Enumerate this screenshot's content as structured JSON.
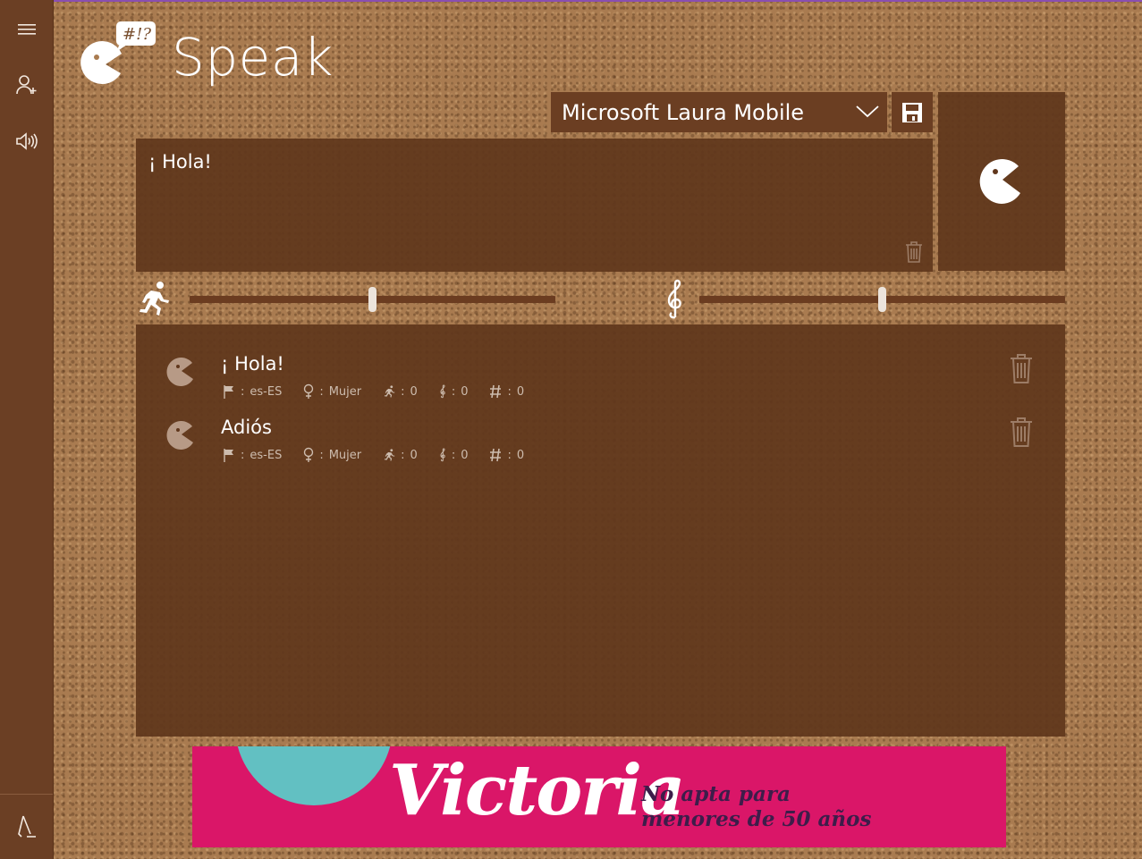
{
  "app": {
    "title": "Speak",
    "logo_bubble": "#!?"
  },
  "sidebar": {
    "items": [
      {
        "name": "hamburger-menu",
        "icon": "hamburger-icon"
      },
      {
        "name": "add-voice-profile",
        "icon": "person-add-icon"
      },
      {
        "name": "voice-settings",
        "icon": "speaker-icon"
      }
    ],
    "bottom": {
      "name": "pronunciation",
      "icon": "pen-icon"
    }
  },
  "voice": {
    "selected": "Microsoft Laura Mobile"
  },
  "editor": {
    "text": "¡ Hola!"
  },
  "sliders": {
    "speed": {
      "icon": "runner-icon",
      "value": 0.5
    },
    "pitch": {
      "icon": "treble-clef-icon",
      "value": 0.5
    }
  },
  "history": {
    "items": [
      {
        "text": "¡ Hola!",
        "lang": "es-ES",
        "gender": "Mujer",
        "speed": "0",
        "pitch": "0",
        "count": "0",
        "sep": ":"
      },
      {
        "text": "Adiós",
        "lang": "es-ES",
        "gender": "Mujer",
        "speed": "0",
        "pitch": "0",
        "count": "0",
        "sep": ":"
      }
    ]
  },
  "ad": {
    "brand": "Victoria",
    "tagline_line1": "No apta para",
    "tagline_line2": "menores de 50 años"
  },
  "colors": {
    "sidebar": "#6b3f24",
    "panel": "#60371c",
    "accent_ad": "#da1668",
    "ad_circle": "#62c0c2"
  }
}
